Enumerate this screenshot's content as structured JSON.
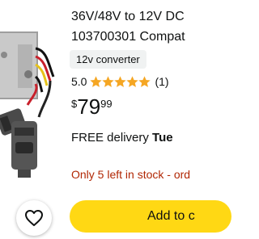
{
  "product": {
    "title_line1": "36V/48V to 12V DC",
    "title_line2": "103700301 Compat",
    "variant_chip": "12v converter",
    "rating_value": "5.0",
    "rating_stars": 5,
    "review_count": "(1)",
    "price_symbol": "$",
    "price_whole": "79",
    "price_fraction": "99",
    "delivery_text": "FREE delivery ",
    "delivery_day": "Tue",
    "stock_text": "Only 5 left in stock - ord"
  },
  "actions": {
    "add_to_cart": "Add to c",
    "wishlist_icon": "heart-icon"
  },
  "colors": {
    "star": "#f5a623",
    "stock": "#b12704",
    "button": "#ffd814",
    "chip": "#f0f2f2"
  }
}
